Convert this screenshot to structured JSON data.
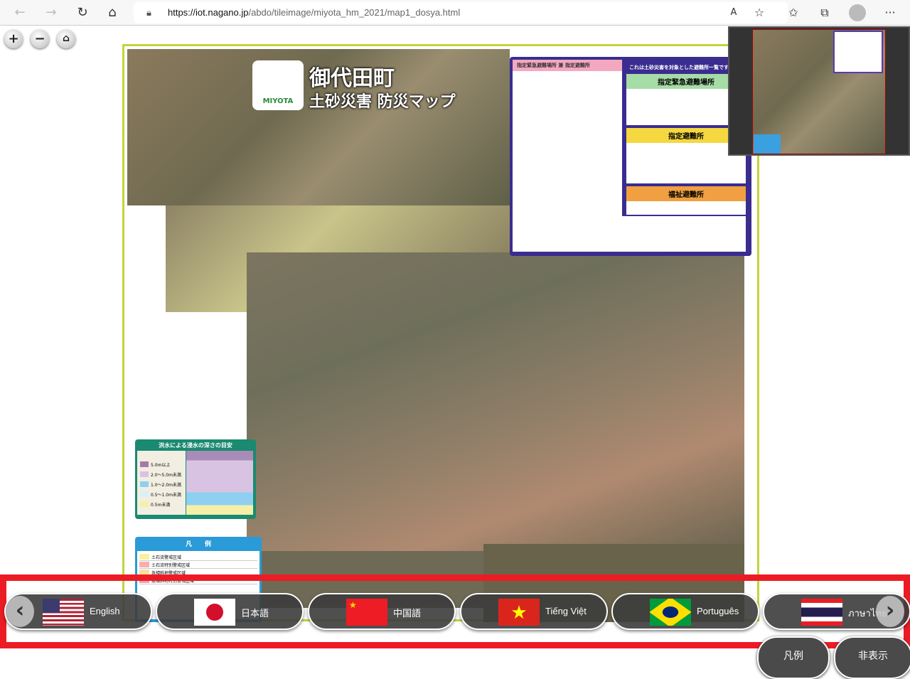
{
  "browser": {
    "url_host": "https://iot.nagano.jp",
    "url_path": "/abdo/tileimage/miyota_hm_2021/map1_dosya.html"
  },
  "map_controls": {
    "zoom_in": "+",
    "zoom_out": "−",
    "home": "⌂"
  },
  "map": {
    "title": "御代田町",
    "subtitle": "土砂災害 防災マップ",
    "logo_text": "MIYOTA",
    "shelter_panel": {
      "heading_left": "指定緊急避難場所 兼 指定避難所",
      "heading_right": "これは土砂災害を対象とした避難所一覧です",
      "section_emergency": "指定緊急避難場所",
      "section_designated": "指定避難所",
      "section_welfare": "福祉避難所"
    },
    "flood_panel": {
      "title": "洪水による浸水の深さの目安",
      "levels": [
        "5.0m以上",
        "2.0〜5.0m未満",
        "1.0〜2.0m未満",
        "0.5〜1.0m未満",
        "0.5m未満"
      ],
      "colors": [
        "#a57aa8",
        "#d8c3e3",
        "#8fd0f0",
        "#d8f0f8",
        "#f4f0a8"
      ]
    },
    "legend_panel": {
      "title": "凡　　例",
      "items": [
        "土石流警戒区域",
        "土石流特別警戒区域",
        "急傾斜地警戒区域",
        "急傾斜地特別警戒区域"
      ]
    }
  },
  "languages": [
    {
      "label": "English",
      "flag": "us"
    },
    {
      "label": "日本語",
      "flag": "jp"
    },
    {
      "label": "中国語",
      "flag": "cn"
    },
    {
      "label": "Tiếng Việt",
      "flag": "vn"
    },
    {
      "label": "Português",
      "flag": "br"
    },
    {
      "label": "ภาษาไทย",
      "flag": "th"
    }
  ],
  "buttons": {
    "legend": "凡例",
    "hide": "非表示"
  },
  "colors": {
    "highlight_border": "#ec1c24",
    "map_border": "#c3d43a",
    "button_bg": "#4a4a4a"
  }
}
